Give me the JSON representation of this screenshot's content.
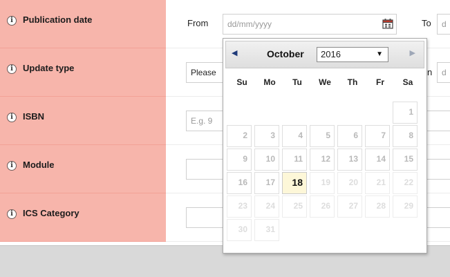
{
  "rows": [
    {
      "label": "Publication date"
    },
    {
      "label": "Update type"
    },
    {
      "label": "ISBN"
    },
    {
      "label": "Module"
    },
    {
      "label": "ICS Category"
    }
  ],
  "publication_date": {
    "from_label": "From",
    "to_label": "To",
    "from_placeholder": "dd/mm/yyyy",
    "to_placeholder_partial": "d"
  },
  "update_type": {
    "select_value": "Please",
    "to_fragment": "n",
    "to_partial": "d"
  },
  "isbn": {
    "placeholder": "E.g. 9"
  },
  "datepicker": {
    "month": "October",
    "year": "2016",
    "prev_symbol": "◀",
    "next_symbol": "▶",
    "weekdays": [
      "Su",
      "Mo",
      "Tu",
      "We",
      "Th",
      "Fr",
      "Sa"
    ],
    "today": "18",
    "days": [
      "1",
      "2",
      "3",
      "4",
      "5",
      "6",
      "7",
      "8",
      "9",
      "10",
      "11",
      "12",
      "13",
      "14",
      "15",
      "16",
      "17",
      "18",
      "19",
      "20",
      "21",
      "22",
      "23",
      "24",
      "25",
      "26",
      "27",
      "28",
      "29",
      "30",
      "31"
    ]
  },
  "icons": {
    "info": "info-icon",
    "calendar": "calendar-icon"
  },
  "colors": {
    "label_bg": "#f7b5ab",
    "today_bg": "#fdf7d8",
    "prev_arrow": "#1f3b7a"
  }
}
